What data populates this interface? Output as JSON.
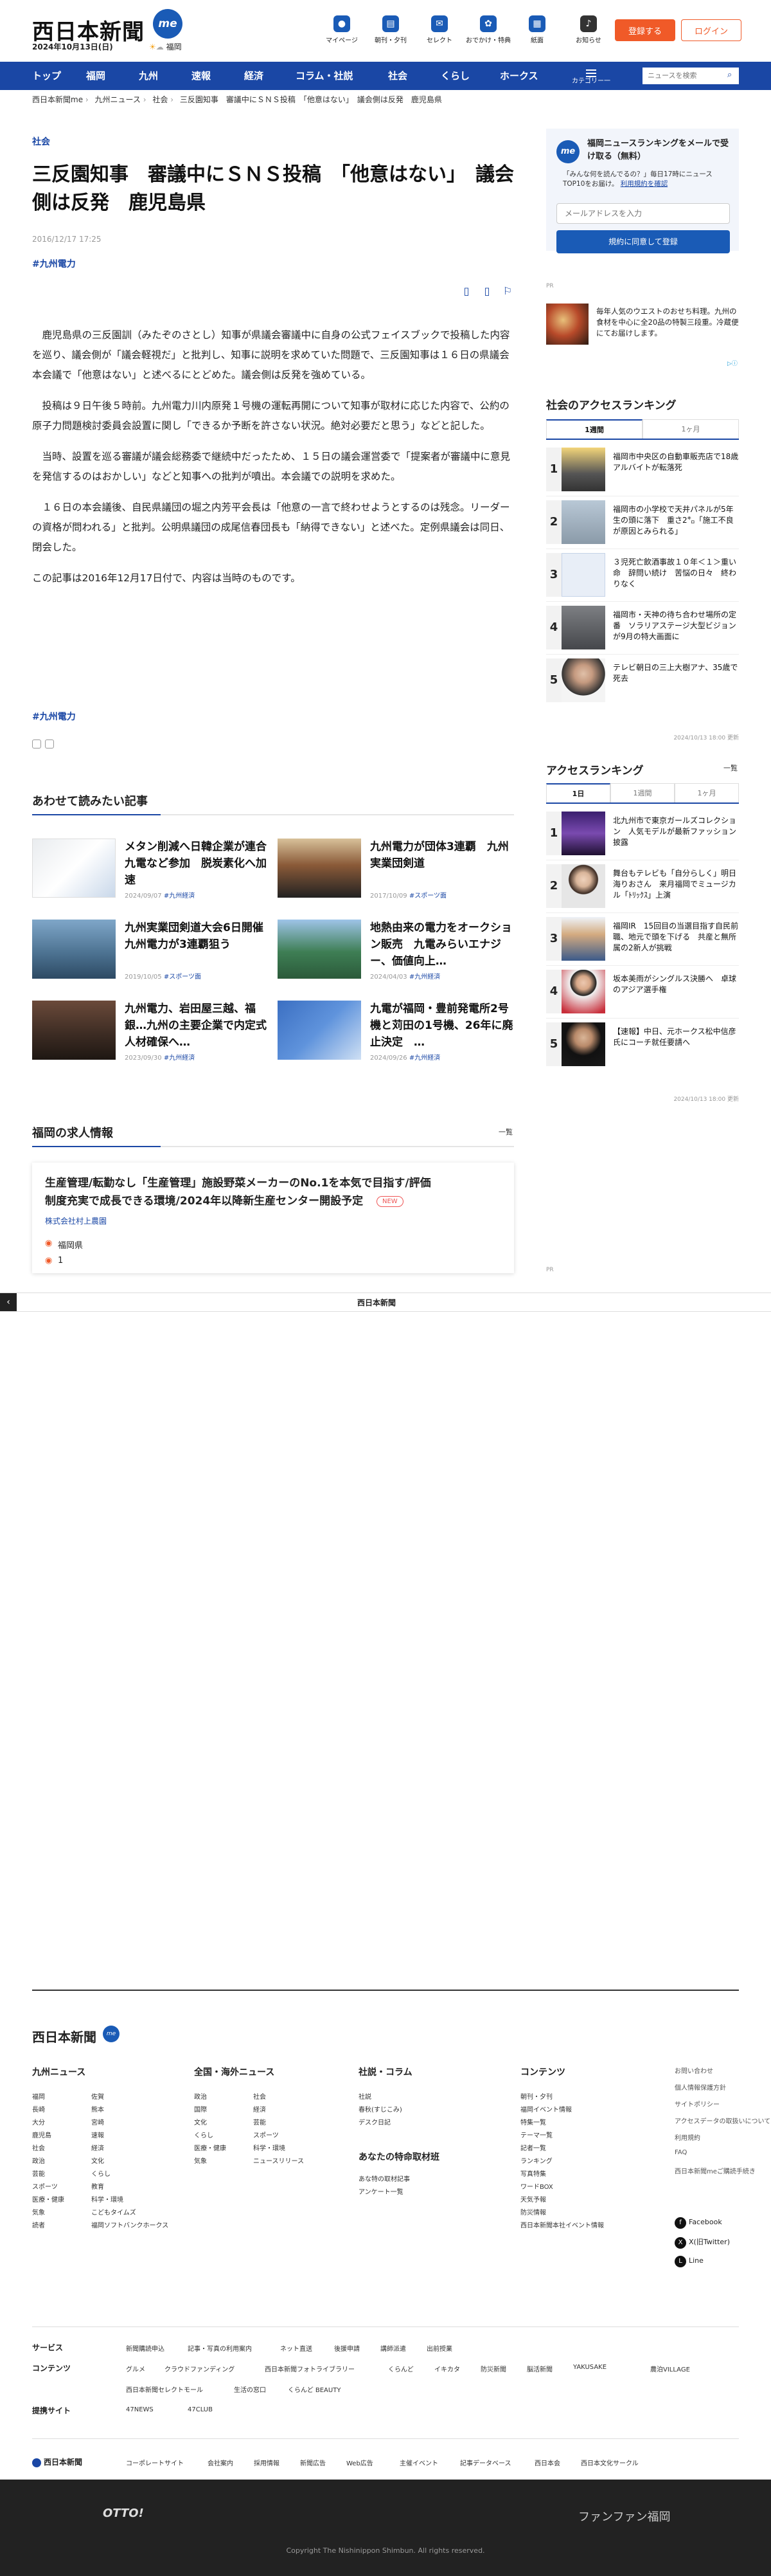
{
  "header": {
    "logo": "西日本新聞",
    "me": "me",
    "date": "2024年10月13日(日)",
    "weather": "福岡",
    "icons": [
      {
        "label": "マイページ",
        "icon": "user-icon"
      },
      {
        "label": "朝刊・夕刊",
        "icon": "newspaper-icon"
      },
      {
        "label": "セレクト",
        "icon": "select-icon"
      },
      {
        "label": "おでかけ・特典",
        "icon": "ticket-icon"
      },
      {
        "label": "紙面",
        "icon": "paper-icon"
      },
      {
        "label": "お知らせ",
        "icon": "bell-icon"
      }
    ],
    "register": "登録する",
    "login": "ログイン"
  },
  "nav": {
    "items": [
      "トップ",
      "福岡",
      "九州",
      "速報",
      "経済",
      "コラム・社説",
      "社会",
      "くらし",
      "ホークス"
    ],
    "category": "カテゴリー一覧",
    "search_placeholder": "ニュースを検索"
  },
  "breadcrumb": [
    "西日本新聞me",
    "九州ニュース",
    "社会",
    "三反園知事　審議中にＳＮＳ投稿　「他意はない」　議会側は反発　鹿児島県"
  ],
  "article": {
    "category": "社会",
    "title": "三反園知事　審議中にＳＮＳ投稿　「他意はない」　議会側は反発　鹿児島県",
    "date": "2016/12/17 17:25",
    "tag": "#九州電力",
    "paragraphs": [
      "　鹿児島県の三反園訓（みたぞのさとし）知事が県議会審議中に自身の公式フェイスブックで投稿した内容を巡り、議会側が「議会軽視だ」と批判し、知事に説明を求めていた問題で、三反園知事は１６日の県議会本会議で「他意はない」と述べるにとどめた。議会側は反発を強めている。",
      "　投稿は９日午後５時前。九州電力川内原発１号機の運転再開について知事が取材に応じた内容で、公約の原子力問題検討委員会設置に関し「できるか予断を許さない状況。絶対必要だと思う」などと記した。",
      "　当時、設置を巡る審議が議会総務委で継続中だったため、１５日の議会運営委で「提案者が審議中に意見を発信するのはおかしい」などと知事への批判が噴出。本会議での説明を求めた。",
      "　１６日の本会議後、自民県議団の堀之内芳平会長は「他意の一言で終わせようとするのは残念。リーダーの資格が問われる」と批判。公明県議団の成尾信春団長も「納得できない」と述べた。定例県議会は同日、閉会した。",
      "この記事は2016年12月17日付で、内容は当時のものです。"
    ],
    "tag2": "#九州電力"
  },
  "related": {
    "heading": "あわせて読みたい記事",
    "items": [
      {
        "title": "メタン削減へ日韓企業が連合　九電など参加　脱炭素化へ加速",
        "date": "2024/09/07",
        "tag": "#九州経済"
      },
      {
        "title": "九州電力が団体3連覇　九州実業団剣道",
        "date": "2017/10/09",
        "tag": "#スポーツ面"
      },
      {
        "title": "九州実業団剣道大会6日開催　九州電力が3連覇狙う",
        "date": "2019/10/05",
        "tag": "#スポーツ面"
      },
      {
        "title": "地熱由来の電力をオークション販売　九電みらいエナジー、価値向上…",
        "date": "2024/04/03",
        "tag": "#九州経済"
      },
      {
        "title": "九州電力、岩田屋三越、福銀…九州の主要企業で内定式　人材確保へ…",
        "date": "2023/09/30",
        "tag": "#九州経済"
      },
      {
        "title": "九電が福岡・豊前発電所2号機と苅田の1号機、26年に廃止決定　…",
        "date": "2024/09/26",
        "tag": "#九州経済"
      }
    ]
  },
  "jobs": {
    "heading": "福岡の求人情報",
    "all": "一覧",
    "title": "生産管理/転勤なし「生産管理」施設野菜メーカーのNo.1を本気で目指す/評価制度充実で成長できる環境/2024年以降新生産センター開設予定",
    "new_badge": "NEW",
    "company": "株式会社村上農園",
    "location": "福岡県",
    "salary": "1"
  },
  "adbar": {
    "logo": "西日本新聞"
  },
  "sidebar": {
    "promo_title": "福岡ニュースランキングをメールで受け取る（無料）",
    "promo_sub": "「みんな何を読んでるの？」毎日17時にニュースTOP10をお届け。",
    "promo_link": "利用規約を確認",
    "promo_placeholder": "メールアドレスを入力",
    "promo_button": "規約に同意して登録",
    "pr": "PR",
    "ad_text": "毎年人気のウエストのおせち料理。九州の食材を中心に全20品の特製三段重。冷蔵便にてお届けします。",
    "ranking1": {
      "heading": "社会のアクセスランキング",
      "tabs": [
        "1週間",
        "1ヶ月"
      ],
      "items": [
        "福岡市中央区の自動車販売店で18歳アルバイトが転落死",
        "福岡市の小学校で天井パネルが5年生の頭に落下　重さ2㌔「施工不良が原因とみられる」",
        "３児死亡飲酒事故１０年＜１＞重い命　辞問い続け　苦悩の日々　終わりなく",
        "福岡市・天神の待ち合わせ場所の定番　ソラリアステージ大型ビジョンが9月の特大画面に",
        "テレビ朝日の三上大樹アナ、35歳で死去"
      ],
      "updated": "2024/10/13 18:00 更新"
    },
    "ranking2": {
      "heading": "アクセスランキング",
      "all": "一覧",
      "tabs": [
        "1日",
        "1週間",
        "1ヶ月"
      ],
      "items": [
        "北九州市で東京ガールズコレクション　人気モデルが最新ファッション披露",
        "舞台もテレビも「自分らしく」明日海りおさん　来月福岡でミュージカル「ﾄﾘｯｸｽ」上演",
        "福岡IR　15回目の当選目指す自民前職、地元で頭を下げる　共産と無所属の2新人が挑戦",
        "坂本美雨がシングルス決勝へ　卓球のアジア選手権",
        "【速報】中日、元ホークス松中信彦氏にコーチ就任要請へ"
      ],
      "updated": "2024/10/13 18:00 更新"
    },
    "pr2": "PR"
  },
  "footer": {
    "logo": "西日本新聞",
    "me": "me",
    "cols": [
      {
        "h": "九州ニュース",
        "links": [
          "福岡",
          "佐賀",
          "長崎",
          "熊本",
          "大分",
          "宮崎",
          "鹿児島",
          "速報",
          "社会",
          "経済",
          "政治",
          "文化",
          "芸能",
          "くらし",
          "スポーツ",
          "教育",
          "医療・健康",
          "科学・環境",
          "気象",
          "こどもタイムズ",
          "読者",
          "福岡ソフトバンクホークス"
        ]
      },
      {
        "h": "全国・海外ニュース",
        "links": [
          "政治",
          "社会",
          "国際",
          "経済",
          "文化",
          "芸能",
          "くらし",
          "スポーツ",
          "医療・健康",
          "科学・環境",
          "気象",
          "ニュースリリース"
        ]
      },
      {
        "h": "社説・コラム",
        "links": [
          "社説",
          "春秋(すじこみ)",
          "デスク日記"
        ],
        "h2": "あなたの特命取材班",
        "links2": [
          "あな特の取材記事",
          "アンケート一覧"
        ]
      },
      {
        "h": "コンテンツ",
        "links": [
          "朝刊・夕刊",
          "福岡イベント情報",
          "特集一覧",
          "テーマ一覧",
          "記者一覧",
          "ランキング",
          "写真特集",
          "ワードBOX",
          "天気予報",
          "防災情報",
          "西日本新聞本社イベント情報"
        ]
      }
    ],
    "side_links": [
      "お問い合わせ",
      "個人情報保護方針",
      "サイトポリシー",
      "アクセスデータの取扱いについて",
      "利用規約",
      "FAQ",
      "西日本新聞meご購読手続き"
    ],
    "social": [
      "Facebook",
      "X(旧Twitter)",
      "Line"
    ],
    "rows": [
      {
        "h": "サービス",
        "links": [
          "新聞購読申込",
          "記事・写真の利用案内",
          "ネット直送",
          "後援申請",
          "講師派遣",
          "出前授業"
        ]
      },
      {
        "h": "コンテンツ",
        "links": [
          "グルメ",
          "クラウドファンディング",
          "西日本新聞フォトライブラリー",
          "くらんど",
          "イキカタ",
          "防災新聞",
          "脳活新聞",
          "YAKUSAKE",
          "農泊VILLAGE",
          "西日本新聞セレクトモール",
          "生活の窓口",
          "くらんど BEAUTY"
        ]
      },
      {
        "h": "提携サイト",
        "links": [
          "47NEWS",
          "47CLUB"
        ]
      }
    ],
    "corp_logo": "西日本新聞",
    "corp_links": [
      "コーポレートサイト",
      "会社案内",
      "採用情報",
      "新聞広告",
      "Web広告",
      "主催イベント",
      "記事データベース",
      "西日本会",
      "西日本文化サークル"
    ],
    "otto": "OTTO!",
    "fanfan": "ファンファン福岡",
    "copyright": "Copyright The Nishinippon Shimbun. All rights reserved."
  }
}
